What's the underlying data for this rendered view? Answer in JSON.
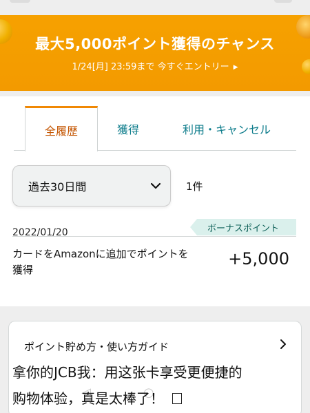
{
  "banner": {
    "title": "最大5,000ポイント獲得のチャンス",
    "subtitle": "1/24[月] 23:59まで 今すぐエントリー",
    "caret": "▶"
  },
  "tabs": [
    {
      "label": "全履歴",
      "active": true
    },
    {
      "label": "獲得",
      "active": false
    },
    {
      "label": "利用・キャンセル",
      "active": false
    }
  ],
  "filter": {
    "period_label": "過去30日間",
    "result_count": "1件"
  },
  "transactions": [
    {
      "date": "2022/01/20",
      "badge": "ボーナスポイント",
      "description": "カードをAmazonに追加でポイントを獲得",
      "amount": "+5,000"
    }
  ],
  "guide": {
    "title": "ポイント貯め方・使い方ガイド"
  },
  "overlay_caption": {
    "line1": "拿你的JCB我：用这张卡享受更便捷的",
    "line2": "购物体验，真是太棒了！"
  },
  "colors": {
    "banner_orange": "#f39a00",
    "active_tab_text": "#c45500",
    "active_tab_accent": "#f08804",
    "link_teal": "#0f7d8c",
    "badge_bg": "#daf0ec"
  }
}
